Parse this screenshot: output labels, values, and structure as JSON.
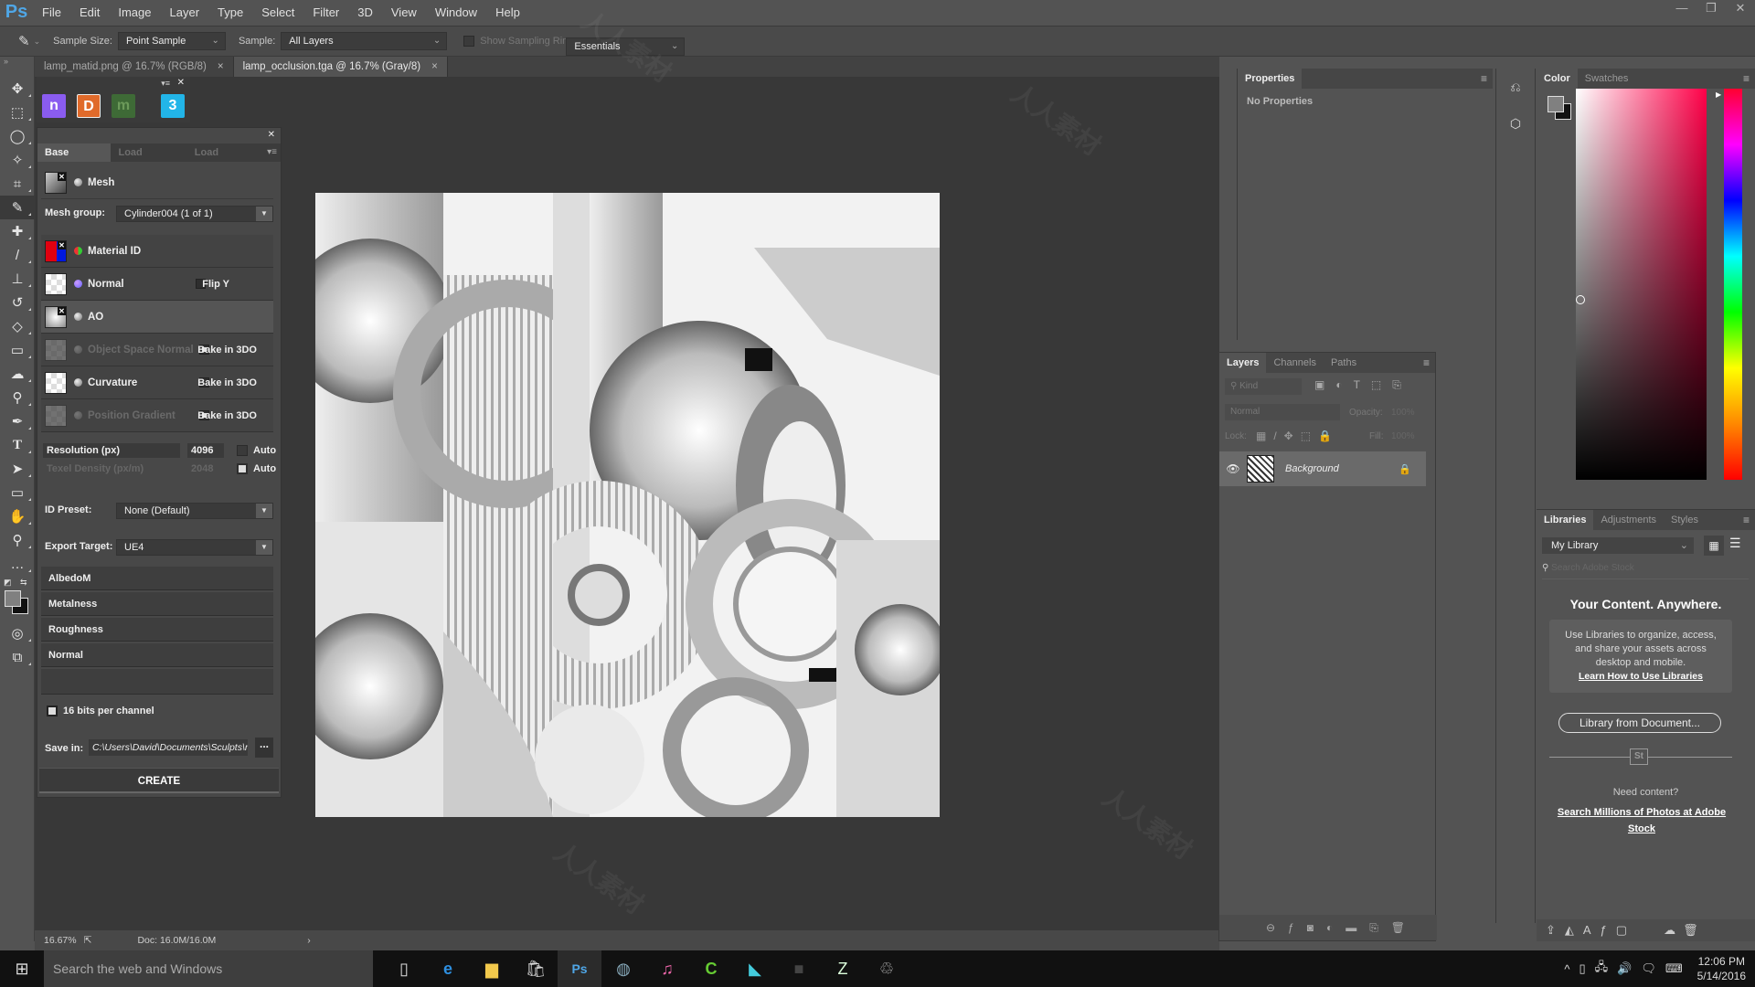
{
  "app": {
    "logo": "Ps",
    "menu": [
      "File",
      "Edit",
      "Image",
      "Layer",
      "Type",
      "Select",
      "Filter",
      "3D",
      "View",
      "Window",
      "Help"
    ],
    "window_controls": [
      "—",
      "❐",
      "✕"
    ]
  },
  "options_bar": {
    "tool_icon": "eyedropper-icon",
    "sample_size_label": "Sample Size:",
    "sample_size_value": "Point Sample",
    "sample_label": "Sample:",
    "sample_value": "All Layers",
    "show_ring_label": "Show Sampling Ring",
    "workspace": "Essentials"
  },
  "doc_tabs": [
    {
      "label": "lamp_matid.png @ 16.7% (RGB/8)",
      "active": false
    },
    {
      "label": "lamp_occlusion.tga @ 16.7% (Gray/8)",
      "active": true
    }
  ],
  "tools": [
    "move",
    "marquee",
    "lasso",
    "magic-wand",
    "crop",
    "eyedropper",
    "healing",
    "brush",
    "stamp",
    "history-brush",
    "eraser",
    "gradient",
    "blur",
    "dodge",
    "pen",
    "type",
    "path-select",
    "rectangle",
    "hand",
    "zoom",
    "more"
  ],
  "plugin": {
    "icons": [
      {
        "letter": "n",
        "color": "#8a5cf0"
      },
      {
        "letter": "D",
        "color": "#e06a2a"
      },
      {
        "letter": "m",
        "color": "#3e6a36"
      },
      {
        "letter": "3",
        "color": "#22b5e8"
      }
    ],
    "tabs": [
      "Base Creator",
      "Load Inputs...",
      "Load Project..."
    ],
    "mesh_label": "Mesh",
    "mesh_group_label": "Mesh group:",
    "mesh_group_value": "Cylinder004 (1 of 1)",
    "inputs": [
      {
        "label": "Material ID",
        "extra": "",
        "checked": false,
        "disabled": false
      },
      {
        "label": "Normal",
        "extra": "Flip Y",
        "checked": false,
        "disabled": false
      },
      {
        "label": "AO",
        "extra": "",
        "checked": false,
        "disabled": false
      },
      {
        "label": "Object Space Normal",
        "extra": "Bake in 3DO",
        "checked": true,
        "disabled": true
      },
      {
        "label": "Curvature",
        "extra": "Bake in 3DO",
        "checked": false,
        "disabled": false
      },
      {
        "label": "Position Gradient",
        "extra": "Bake in 3DO",
        "checked": true,
        "disabled": true
      }
    ],
    "resolution_label": "Resolution (px)",
    "resolution_value": "4096",
    "texel_label": "Texel Density (px/m)",
    "texel_value": "2048",
    "auto_label": "Auto",
    "id_preset_label": "ID Preset:",
    "id_preset_value": "None (Default)",
    "export_target_label": "Export Target:",
    "export_target_value": "UE4",
    "outputs": [
      "AlbedoM",
      "Metalness",
      "Roughness",
      "Normal"
    ],
    "bits_label": "16 bits per channel",
    "save_in_label": "Save in:",
    "save_in_value": "C:\\Users\\David\\Documents\\Sculpts\\rip",
    "browse_label": "...",
    "create_label": "CREATE"
  },
  "status": {
    "zoom": "16.67%",
    "doc": "Doc: 16.0M/16.0M"
  },
  "properties": {
    "tab": "Properties",
    "empty": "No Properties"
  },
  "layers": {
    "tabs": [
      "Layers",
      "Channels",
      "Paths"
    ],
    "filter_placeholder": "Kind",
    "blend_mode": "Normal",
    "opacity_label": "Opacity:",
    "opacity_value": "100%",
    "lock_label": "Lock:",
    "fill_label": "Fill:",
    "fill_value": "100%",
    "items": [
      {
        "name": "Background",
        "visible": true,
        "locked": true
      }
    ]
  },
  "color": {
    "tabs": [
      "Color",
      "Swatches"
    ],
    "foreground": "#808080",
    "background": "#111111",
    "hue": "#ff0048"
  },
  "libraries": {
    "tabs": [
      "Libraries",
      "Adjustments",
      "Styles"
    ],
    "library_select": "My Library",
    "search_placeholder": "Search Adobe Stock",
    "headline": "Your Content. Anywhere.",
    "body": "Use Libraries to organize, access, and share your assets across desktop and mobile.",
    "learn_link": "Learn How to Use Libraries",
    "from_doc_button": "Library from Document...",
    "stock_badge": "St",
    "need_content": "Need content?",
    "stock_link": "Search Millions of Photos at Adobe Stock"
  },
  "taskbar": {
    "search_placeholder": "Search the web and Windows",
    "apps": [
      "task-view",
      "edge",
      "file-explorer",
      "store",
      "photoshop",
      "steam",
      "itunes",
      "camtasia",
      "substance",
      "app-dark",
      "app-z",
      "app-recycle"
    ],
    "time": "12:06 PM",
    "date": "5/14/2016"
  }
}
